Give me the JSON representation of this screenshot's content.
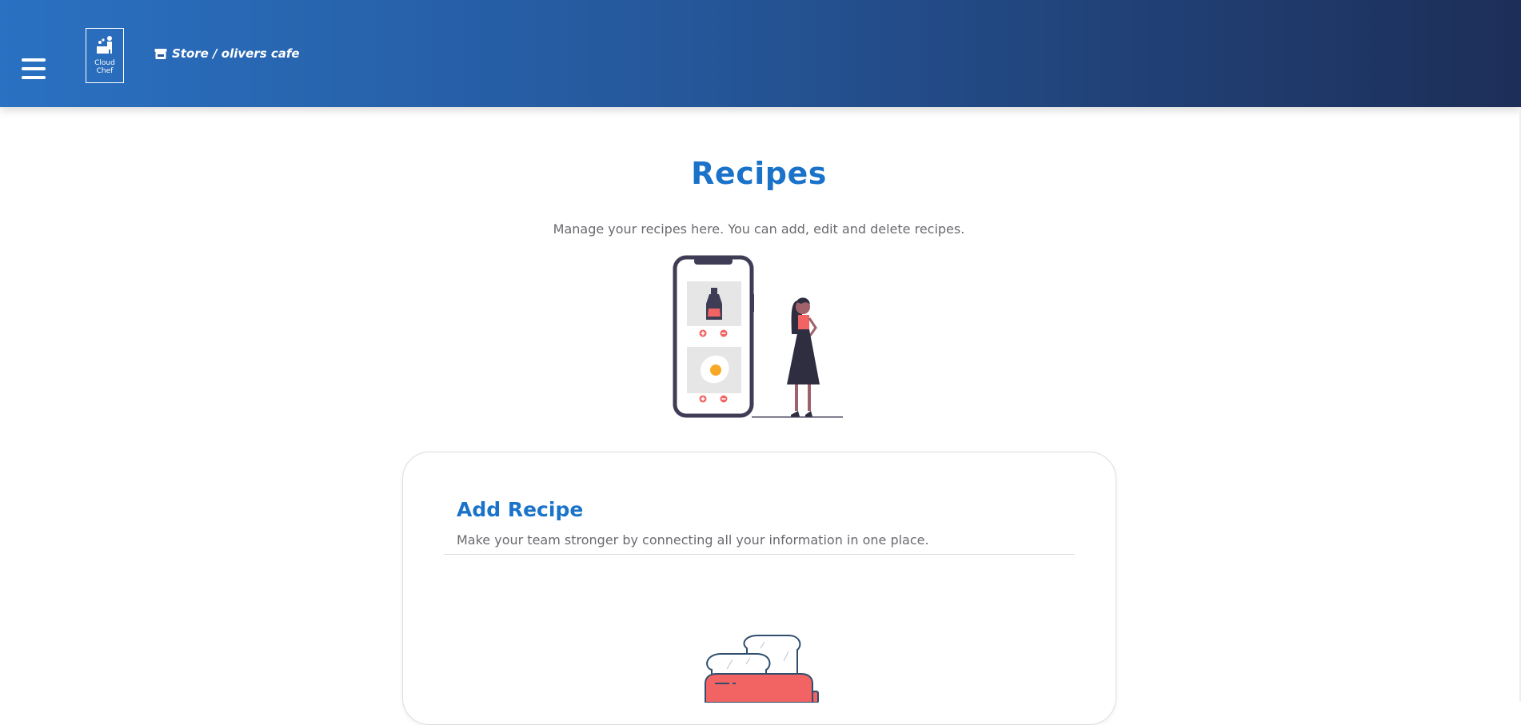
{
  "header": {
    "logo_line1": "Cloud",
    "logo_line2": "Chef",
    "breadcrumb": "Store / olivers cafe",
    "menu_icon": "hamburger-menu-icon",
    "store_icon": "store-icon",
    "gradient_colors": [
      "#2a71c2",
      "#1d2e58"
    ]
  },
  "main": {
    "title": "Recipes",
    "subtitle": "Manage your recipes here. You can add, edit and delete recipes.",
    "hero_illustration": "woman-with-phone-recipes-illustration"
  },
  "card": {
    "title": "Add Recipe",
    "subtitle": "Make your team stronger by connecting all your information in one place.",
    "illustration": "toaster-illustration"
  },
  "colors": {
    "accent": "#1a73c9",
    "muted_text": "#6a6a70",
    "illustration_red": "#f26363",
    "illustration_dark": "#3f3d56"
  }
}
